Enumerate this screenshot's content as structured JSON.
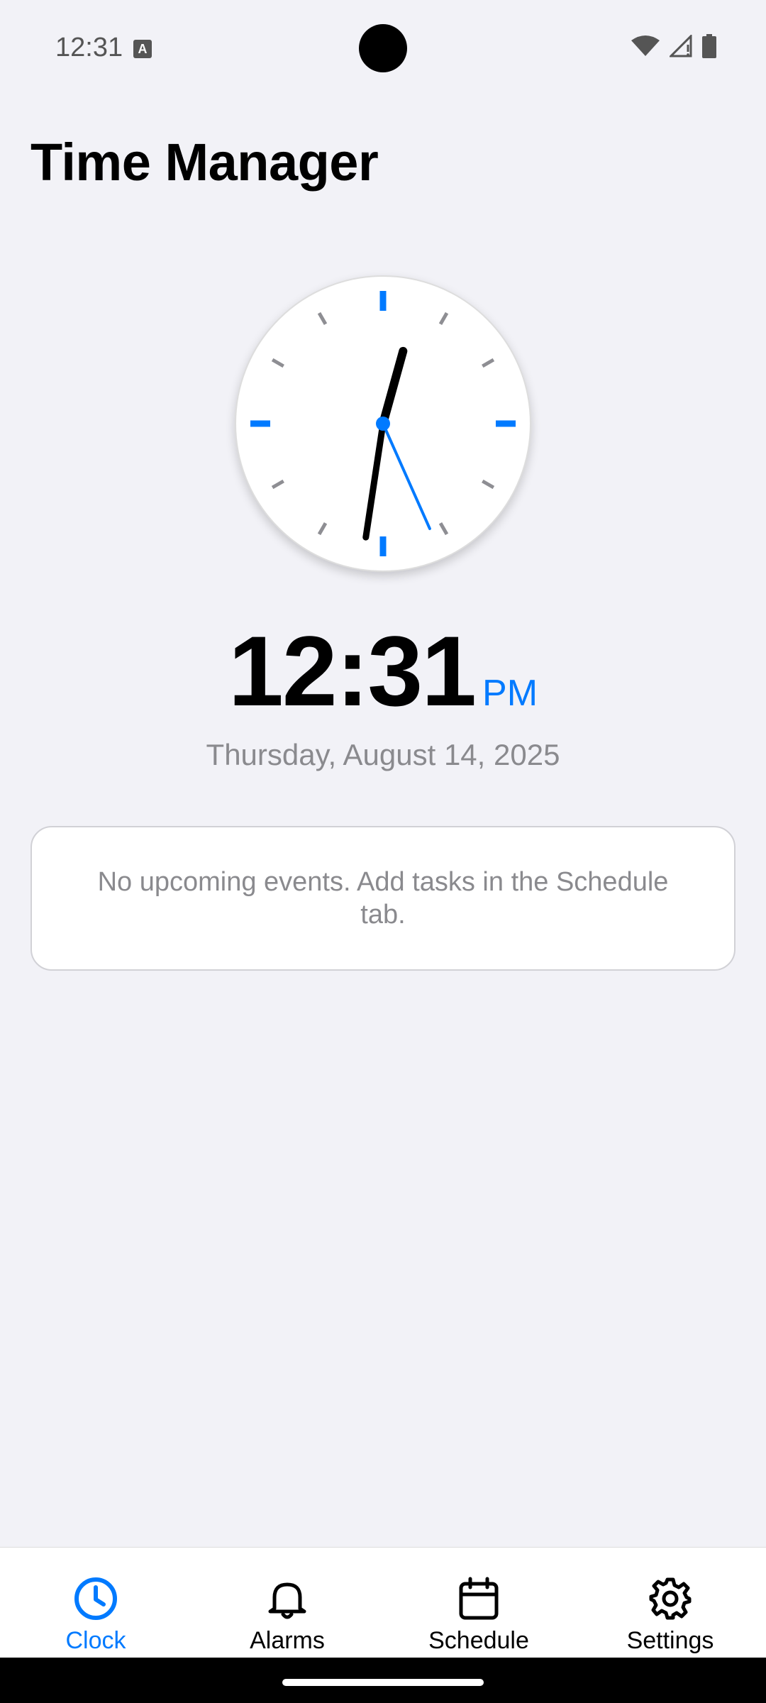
{
  "status_bar": {
    "time": "12:31",
    "icons": [
      "keyboard-a-icon",
      "wifi-icon",
      "signal-icon",
      "battery-icon"
    ]
  },
  "app": {
    "title": "Time Manager"
  },
  "clock": {
    "hour": 12,
    "minute": 31,
    "second": 26,
    "digital_time": "12:31",
    "ampm": "PM",
    "date": "Thursday, August 14, 2025",
    "accent_color": "#007aff"
  },
  "events": {
    "empty_message": "No upcoming events. Add tasks in the Schedule tab."
  },
  "tabs": [
    {
      "label": "Clock",
      "icon": "clock-icon",
      "active": true
    },
    {
      "label": "Alarms",
      "icon": "bell-icon",
      "active": false
    },
    {
      "label": "Schedule",
      "icon": "calendar-icon",
      "active": false
    },
    {
      "label": "Settings",
      "icon": "gear-icon",
      "active": false
    }
  ]
}
